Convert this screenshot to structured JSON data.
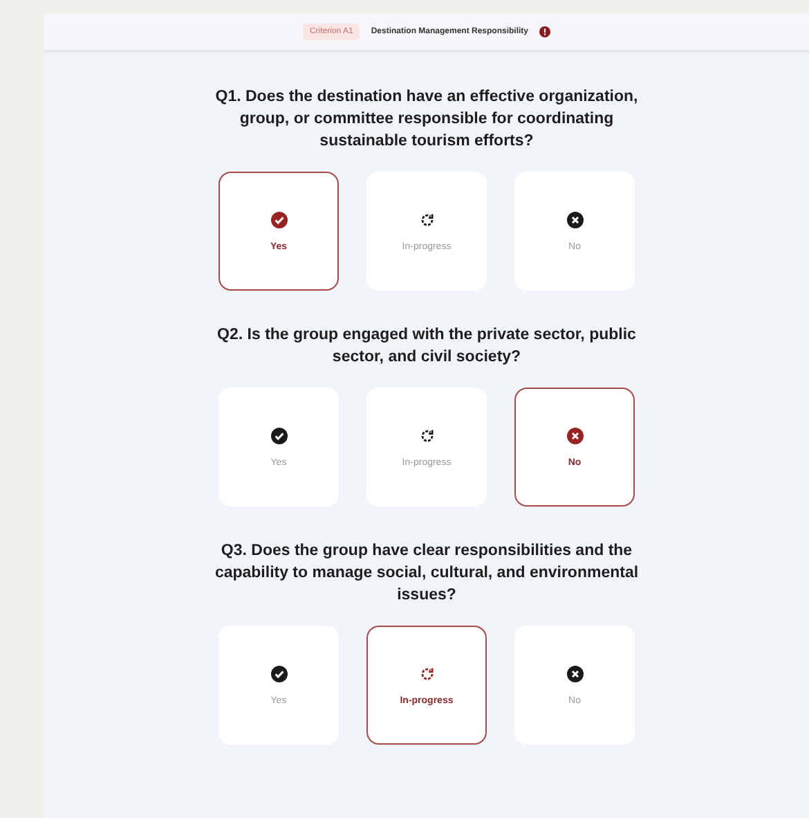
{
  "header": {
    "badge": "Criterion A1",
    "title": "Destination Management Responsibility"
  },
  "questions": [
    {
      "text": "Q1. Does the destination have an effective organization, group, or committee responsible for coordinating sustainable tourism efforts?",
      "options": [
        {
          "kind": "yes",
          "label": "Yes",
          "selected": true
        },
        {
          "kind": "progress",
          "label": "In-progress",
          "selected": false
        },
        {
          "kind": "no",
          "label": "No",
          "selected": false
        }
      ]
    },
    {
      "text": "Q2. Is the group engaged with the private sector, public sector, and civil society?",
      "options": [
        {
          "kind": "yes",
          "label": "Yes",
          "selected": false
        },
        {
          "kind": "progress",
          "label": "In-progress",
          "selected": false
        },
        {
          "kind": "no",
          "label": "No",
          "selected": true
        }
      ]
    },
    {
      "text": "Q3. Does the group have clear responsibilities and the capability to manage social, cultural, and environmental issues?",
      "options": [
        {
          "kind": "yes",
          "label": "Yes",
          "selected": false
        },
        {
          "kind": "progress",
          "label": "In-progress",
          "selected": true
        },
        {
          "kind": "no",
          "label": "No",
          "selected": false
        }
      ]
    }
  ]
}
